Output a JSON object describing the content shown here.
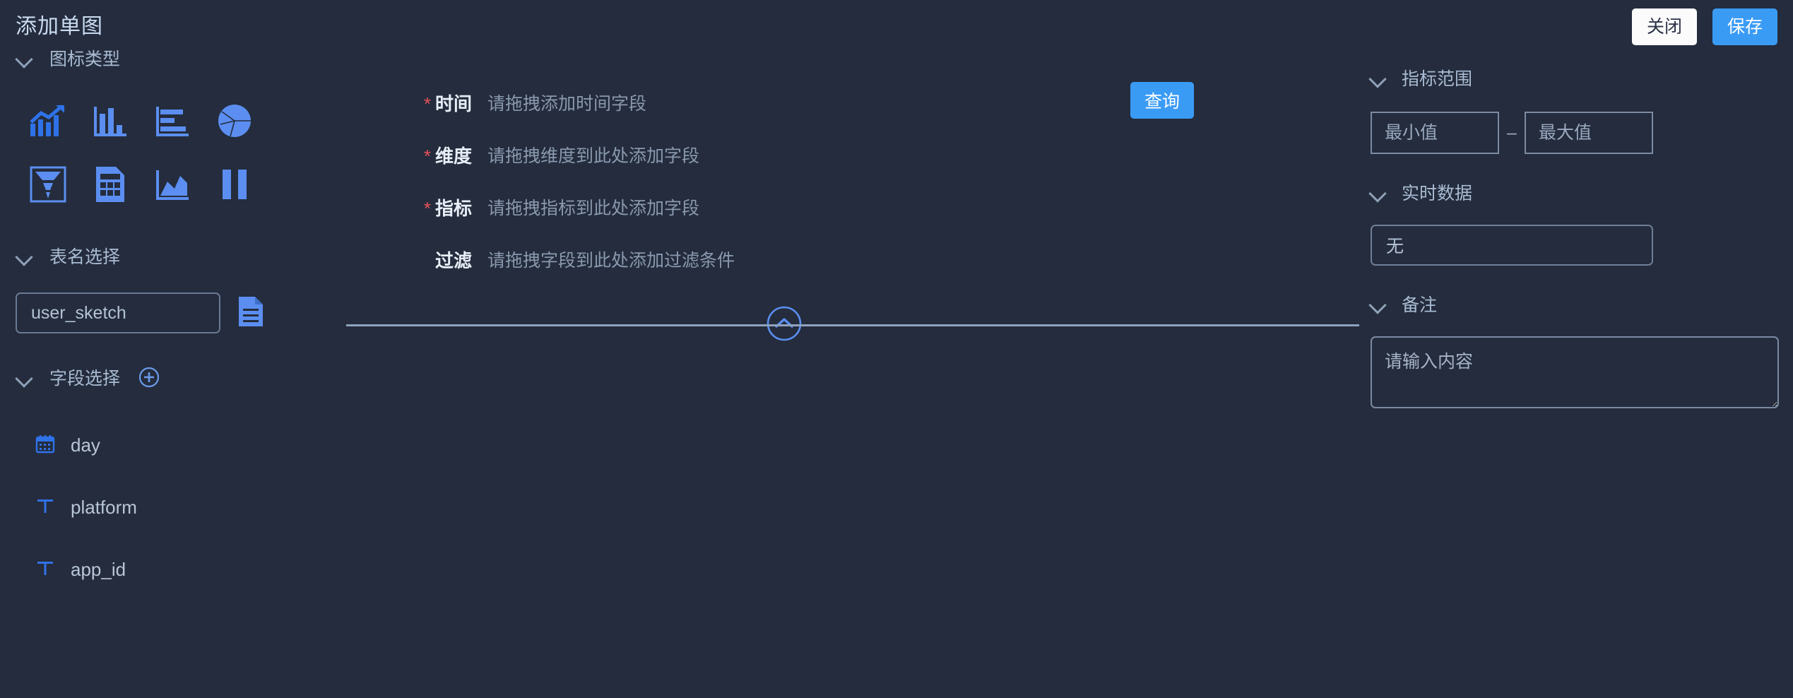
{
  "header": {
    "title": "添加单图",
    "close_label": "关闭",
    "save_label": "保存"
  },
  "sidebar": {
    "chart_type": {
      "title": "图标类型",
      "icons": [
        {
          "name": "trend-line-chart-icon",
          "label": "趋势图"
        },
        {
          "name": "bar-chart-icon",
          "label": "柱状图"
        },
        {
          "name": "horizontal-bar-chart-icon",
          "label": "条形图"
        },
        {
          "name": "pie-chart-icon",
          "label": "饼图"
        },
        {
          "name": "funnel-chart-icon",
          "label": "漏斗图"
        },
        {
          "name": "table-chart-icon",
          "label": "表格"
        },
        {
          "name": "area-chart-icon",
          "label": "面积图"
        },
        {
          "name": "column-pair-chart-icon",
          "label": "双柱图"
        }
      ]
    },
    "table_select": {
      "title": "表名选择",
      "selected": "user_sketch",
      "doc_icon": "document-icon"
    },
    "field_select": {
      "title": "字段选择",
      "add_icon": "plus-circle-icon",
      "fields": [
        {
          "name": "day",
          "type_icon": "calendar-icon"
        },
        {
          "name": "platform",
          "type_icon": "text-type-icon"
        },
        {
          "name": "app_id",
          "type_icon": "text-type-icon"
        }
      ]
    }
  },
  "center": {
    "rows": [
      {
        "label": "时间",
        "required": true,
        "placeholder": "请拖拽添加时间字段"
      },
      {
        "label": "维度",
        "required": true,
        "placeholder": "请拖拽维度到此处添加字段"
      },
      {
        "label": "指标",
        "required": true,
        "placeholder": "请拖拽指标到此处添加字段"
      },
      {
        "label": "过滤",
        "required": false,
        "placeholder": "请拖拽字段到此处添加过滤条件"
      }
    ],
    "query_label": "查询",
    "collapse_icon": "chevron-up-circle-icon"
  },
  "right": {
    "metric_range": {
      "title": "指标范围",
      "min_placeholder": "最小值",
      "max_placeholder": "最大值",
      "min_value": "",
      "max_value": "",
      "separator": "–"
    },
    "realtime": {
      "title": "实时数据",
      "selected": "无"
    },
    "remark": {
      "title": "备注",
      "placeholder": "请输入内容",
      "value": ""
    }
  },
  "colors": {
    "background": "#242c3d",
    "accent_blue": "#3a9bf5",
    "icon_blue": "#5b8ef0",
    "required_red": "#e8515a",
    "title_text": "#cbdcf2",
    "muted_text": "#8a99ae"
  }
}
